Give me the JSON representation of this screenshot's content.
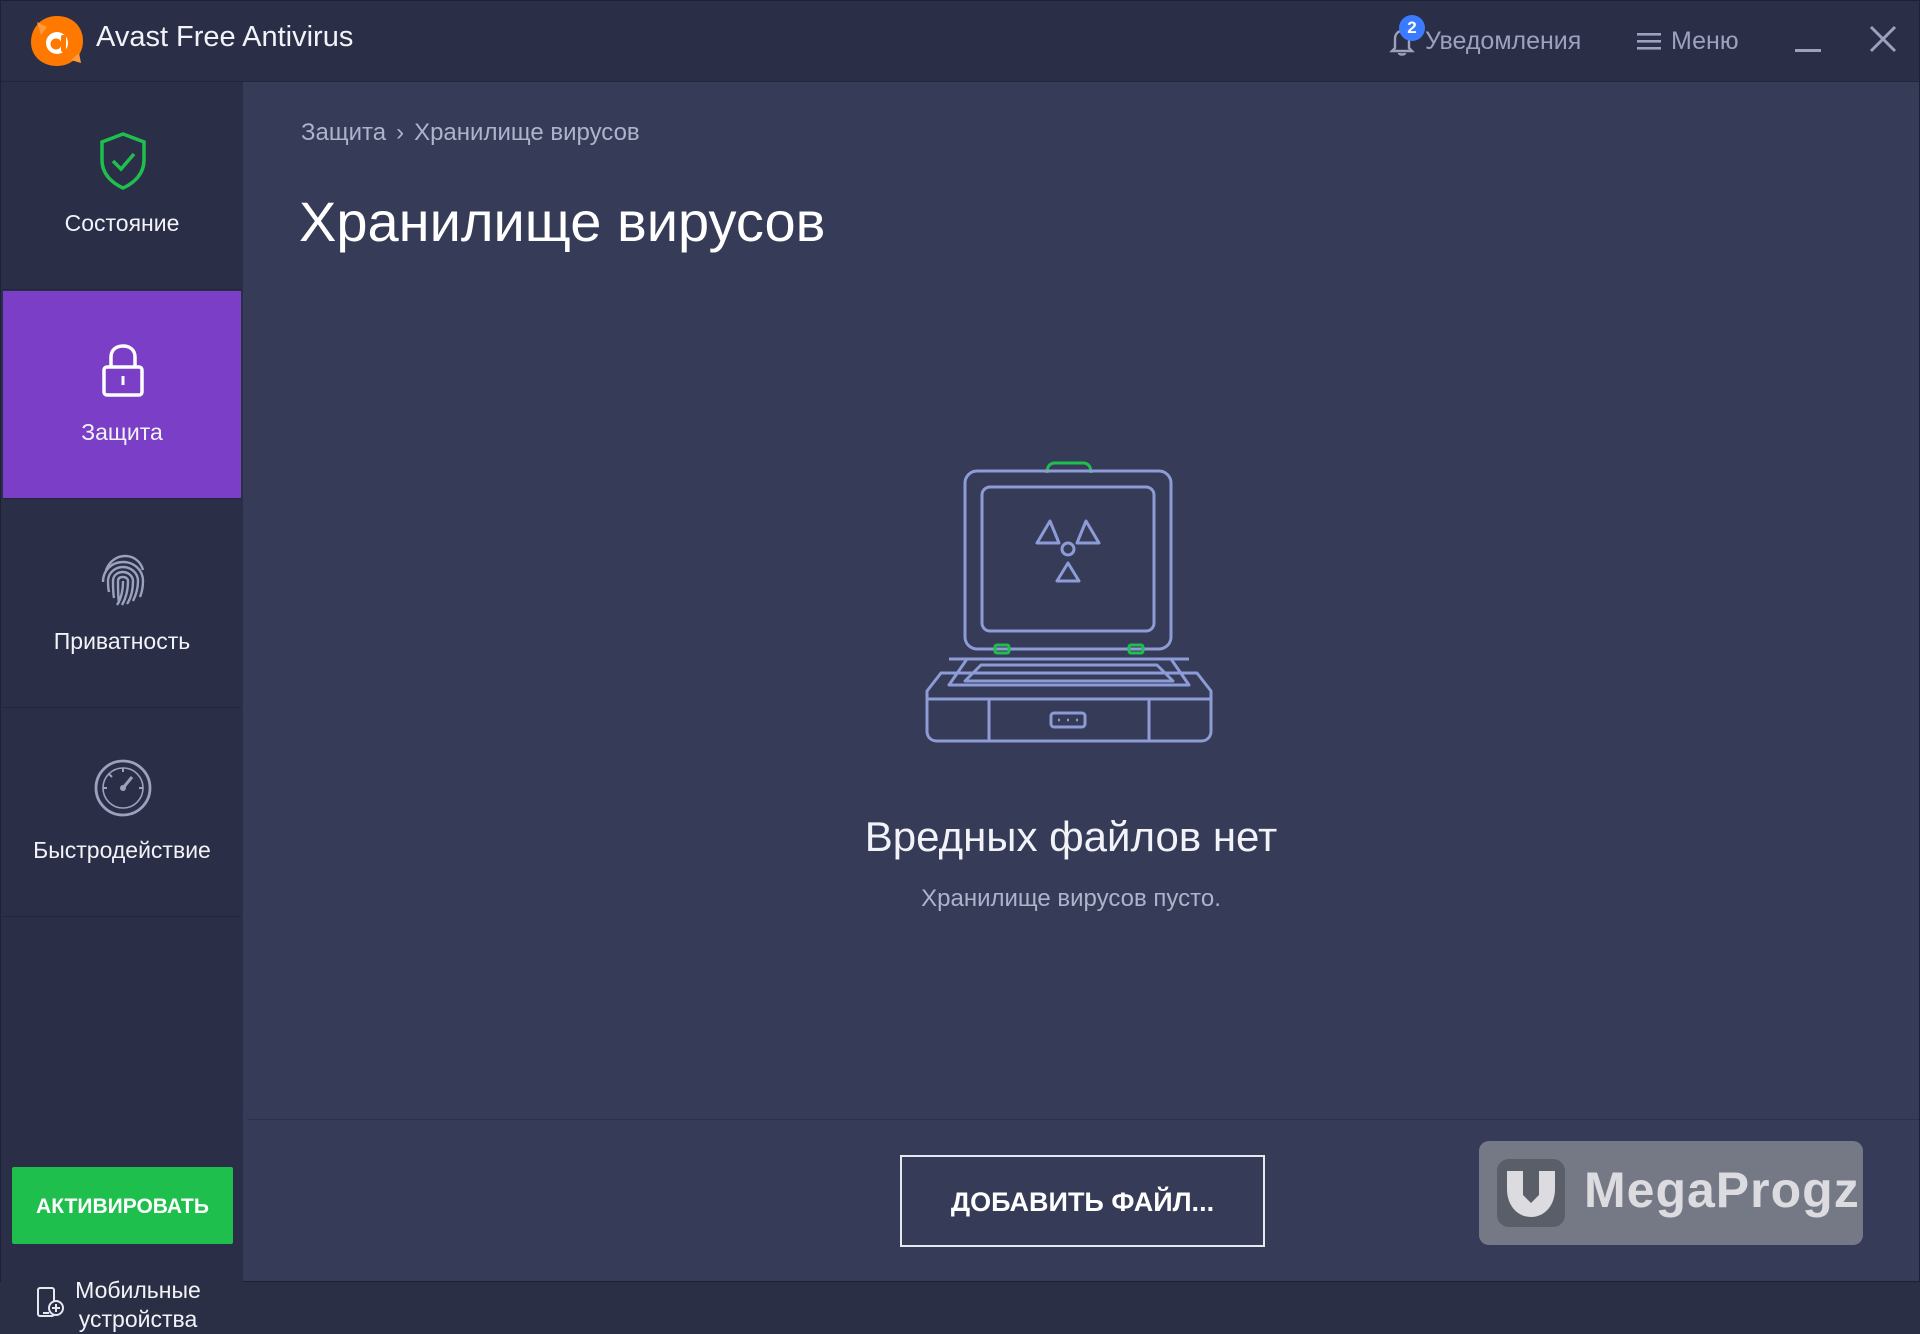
{
  "window": {
    "app_title": "Avast Free Antivirus",
    "notifications": {
      "label": "Уведомления",
      "count": "2"
    },
    "menu_label": "Меню"
  },
  "sidebar": {
    "items": [
      {
        "label": "Состояние",
        "icon": "shield-check-icon",
        "active": false
      },
      {
        "label": "Защита",
        "icon": "lock-icon",
        "active": true
      },
      {
        "label": "Приватность",
        "icon": "fingerprint-icon",
        "active": false
      },
      {
        "label": "Быстродействие",
        "icon": "speedometer-icon",
        "active": false
      }
    ],
    "activate_label": "АКТИВИРОВАТЬ",
    "mobile_label_1": "Мобильные",
    "mobile_label_2": "устройства"
  },
  "main": {
    "breadcrumb": {
      "parent": "Защита",
      "separator": "›",
      "current": "Хранилище вирусов"
    },
    "title": "Хранилище вирусов",
    "empty_title": "Вредных файлов нет",
    "empty_subtitle": "Хранилище вирусов пусто.",
    "add_button_label": "ДОБАВИТЬ ФАЙЛ..."
  },
  "watermark": {
    "text": "MegaProgz"
  },
  "colors": {
    "accent_active": "#7a3ec7",
    "activate_green": "#1ebf4c",
    "badge_blue": "#3b7bff",
    "brand_orange": "#ff7800",
    "sidebar_bg": "#2a2e47",
    "main_bg": "#363b58"
  }
}
